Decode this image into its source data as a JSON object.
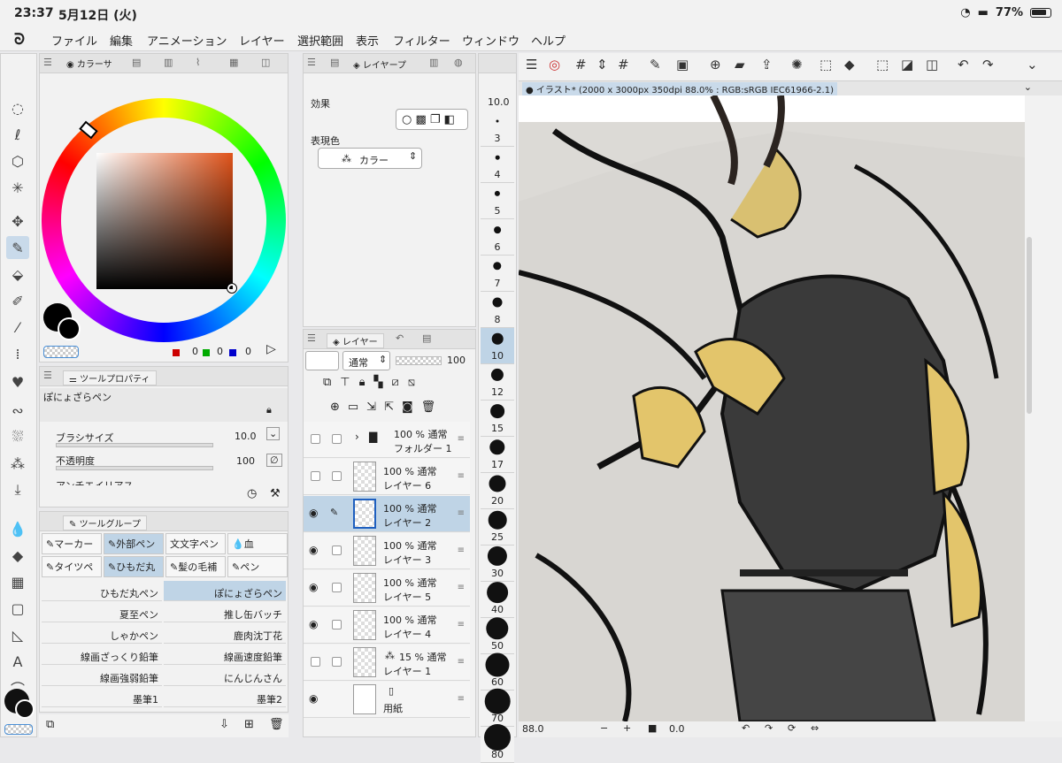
{
  "status": {
    "time": "23:37",
    "date": "5月12日 (火)",
    "battery": "77%"
  },
  "menu": [
    "ファイル",
    "編集",
    "アニメーション",
    "レイヤー",
    "選択範囲",
    "表示",
    "フィルター",
    "ウィンドウ",
    "ヘルプ"
  ],
  "color_panel": {
    "tab": "カラーサ",
    "values": [
      "0",
      "0",
      "0"
    ]
  },
  "tool_property": {
    "tab": "ツールプロパティ",
    "brush_name": "ぽにょざらペン",
    "size_label": "ブラシサイズ",
    "size_value": "10.0",
    "opacity_label": "不透明度",
    "opacity_value": "100",
    "aa_label": "アンチエイリアス"
  },
  "tool_group": {
    "tab": "ツールグループ",
    "groups": [
      "マーカー",
      "外部ペン",
      "文字ペン",
      "血",
      "タイツペ",
      "ひもだ丸",
      "髪の毛補",
      "ペン"
    ],
    "brushes": [
      [
        "ひもだ丸ペン",
        "ぽにょざらペン"
      ],
      [
        "夏至ペン",
        "推し缶バッチ"
      ],
      [
        "しゃかペン",
        "鹿肉沈丁花"
      ],
      [
        "線画ざっくり鉛筆",
        "線画速度鉛筆"
      ],
      [
        "線画強弱鉛筆",
        "にんじんさん"
      ],
      [
        "墨筆1",
        "墨筆2"
      ]
    ]
  },
  "effect_panel": {
    "tab": "レイヤープ",
    "effect_label": "効果",
    "expr_label": "表現色",
    "expr_value": "カラー"
  },
  "layer_panel": {
    "tab": "レイヤー",
    "blend": "通常",
    "opacity": "100",
    "layers": [
      {
        "l1": "100 % 通常",
        "l2": "フォルダー 1"
      },
      {
        "l1": "100 % 通常",
        "l2": "レイヤー 6"
      },
      {
        "l1": "100 % 通常",
        "l2": "レイヤー 2"
      },
      {
        "l1": "100 % 通常",
        "l2": "レイヤー 3"
      },
      {
        "l1": "100 % 通常",
        "l2": "レイヤー 5"
      },
      {
        "l1": "100 % 通常",
        "l2": "レイヤー 4"
      },
      {
        "l1": "15 % 通常",
        "l2": "レイヤー 1"
      },
      {
        "l1": "",
        "l2": "用紙"
      }
    ]
  },
  "brush_size": {
    "current": "10.0",
    "sizes": [
      "3",
      "4",
      "5",
      "6",
      "7",
      "8",
      "10",
      "12",
      "15",
      "17",
      "20",
      "25",
      "30",
      "40",
      "50",
      "60",
      "70",
      "80"
    ]
  },
  "canvas": {
    "title": "● イラスト* (2000 x 3000px 350dpi 88.0% : RGB:sRGB IEC61966-2.1)",
    "zoom": "88.0",
    "angle": "0.0"
  }
}
